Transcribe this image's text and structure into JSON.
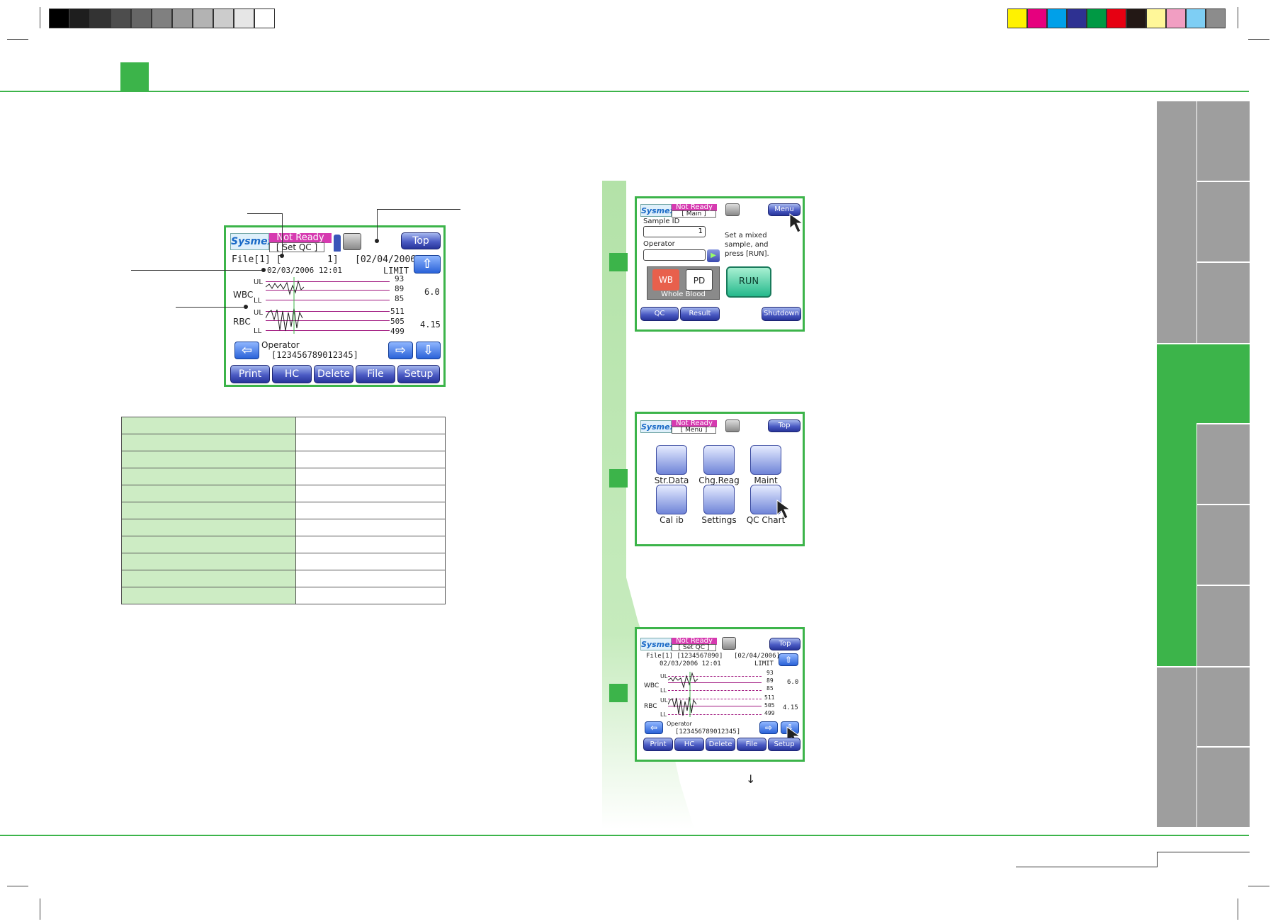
{
  "colors": {
    "accent_green": "#3cb44a",
    "light_green": "#cdecc4",
    "status_magenta": "#d63ab0",
    "tab_gray": "#9b9b9b",
    "button_blue": "#4b5bc4"
  },
  "print_marks": {
    "grayscale": [
      "#000000",
      "#1e1e1e",
      "#333333",
      "#4d4d4d",
      "#666666",
      "#808080",
      "#999999",
      "#b3b3b3",
      "#cccccc",
      "#e6e6e6",
      "#ffffff"
    ],
    "color_bar": [
      "#fff200",
      "#e6007e",
      "#00a0e9",
      "#2e3192",
      "#009944",
      "#e60012",
      "#231815",
      "#fff799",
      "#f19ec2",
      "#7ecef4",
      "#8c8c8c"
    ]
  },
  "main_screen": {
    "logo": "Sysmex",
    "status": "Not Ready",
    "title": "[   Set QC   ]",
    "top_button": "Top",
    "file_line": "File[1] [",
    "file_num": "1]",
    "date_bracket": "[02/04/2006]",
    "datetime": "02/03/2006     12:01",
    "limit": "LIMIT",
    "wbc_label": "WBC",
    "rbc_label": "RBC",
    "ul": "UL",
    "ll": "LL",
    "wbc_values": [
      "93",
      "89",
      "85"
    ],
    "rbc_values": [
      "511",
      "505",
      "499"
    ],
    "wbc_limit": "6.0",
    "rbc_limit": "4.15",
    "operator_label": "Operator",
    "operator_value": "[123456789012345]",
    "buttons": [
      "Print",
      "HC",
      "Delete",
      "File",
      "Setup"
    ]
  },
  "screen1": {
    "logo": "Sysmex",
    "status": "Not Ready",
    "title": "[   Main   ]",
    "menu_button": "Menu",
    "sample_id_label": "Sample ID",
    "sample_id_value": "1",
    "operator_label": "Operator",
    "instruction": "Set a mixed sample, and press [RUN].",
    "wb": "WB",
    "pd": "PD",
    "mode": "Whole Blood",
    "run": "RUN",
    "buttons": [
      "QC",
      "Result",
      "Shutdown"
    ]
  },
  "screen2": {
    "logo": "Sysmex",
    "status": "Not Ready",
    "title": "[   Menu   ]",
    "top_button": "Top",
    "icons": [
      "Str.Data",
      "Chg.Reag",
      "Maint",
      "Cal ib",
      "Settings",
      "QC Chart"
    ]
  },
  "screen3": {
    "logo": "Sysmex",
    "status": "Not Ready",
    "title": "[   Set QC   ]",
    "top_button": "Top",
    "file_line": "File[1] [1234567890]",
    "date_bracket": "[02/04/2006]",
    "datetime": "02/03/2006    12:01",
    "limit": "LIMIT",
    "wbc_label": "WBC",
    "rbc_label": "RBC",
    "ul": "UL",
    "ll": "LL",
    "wbc_values": [
      "93",
      "89",
      "85"
    ],
    "rbc_values": [
      "511",
      "505",
      "499"
    ],
    "wbc_limit": "6.0",
    "rbc_limit": "4.15",
    "operator_label": "Operator",
    "operator_value": "[123456789012345]",
    "buttons": [
      "Print",
      "HC",
      "Delete",
      "File",
      "Setup"
    ]
  },
  "down_arrow_note": "↓",
  "table_rows": 11
}
